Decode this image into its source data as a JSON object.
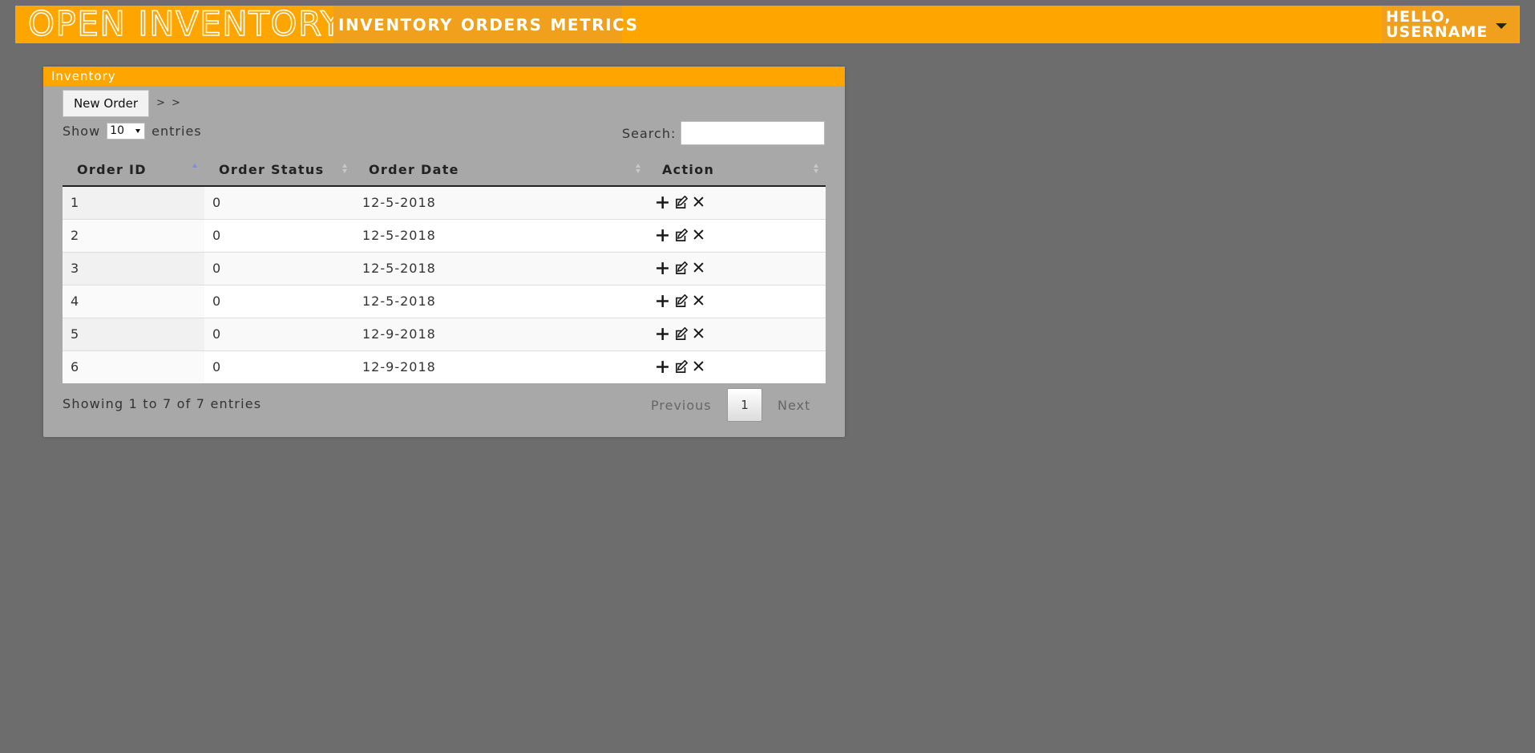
{
  "navbar": {
    "brand": "OPEN INVENTORY",
    "links": [
      "INVENTORY",
      "ORDERS",
      "METRICS"
    ],
    "user_line1": "HELLO,",
    "user_line2": "USERNAME"
  },
  "panel": {
    "heading": "Inventory",
    "new_order_label": "New Order",
    "breadcrumb_sep": ">",
    "show_label": "Show",
    "entries_label": "entries",
    "page_length": "10",
    "search_label": "Search:",
    "search_value": ""
  },
  "table": {
    "columns": [
      "Order ID",
      "Order Status",
      "Order Date",
      "Action"
    ],
    "rows": [
      {
        "id": "1",
        "status": "0",
        "date": "12-5-2018"
      },
      {
        "id": "2",
        "status": "0",
        "date": "12-5-2018"
      },
      {
        "id": "3",
        "status": "0",
        "date": "12-5-2018"
      },
      {
        "id": "4",
        "status": "0",
        "date": "12-5-2018"
      },
      {
        "id": "5",
        "status": "0",
        "date": "12-9-2018"
      },
      {
        "id": "6",
        "status": "0",
        "date": "12-9-2018"
      }
    ],
    "action_icons": [
      "plus-icon",
      "edit-icon",
      "close-icon"
    ]
  },
  "footer": {
    "info": "Showing 1 to 7 of 7 entries",
    "previous": "Previous",
    "page": "1",
    "next": "Next"
  },
  "colors": {
    "accent": "#ffa500",
    "background": "#6d6d6d",
    "panel": "#a8a8a8"
  }
}
